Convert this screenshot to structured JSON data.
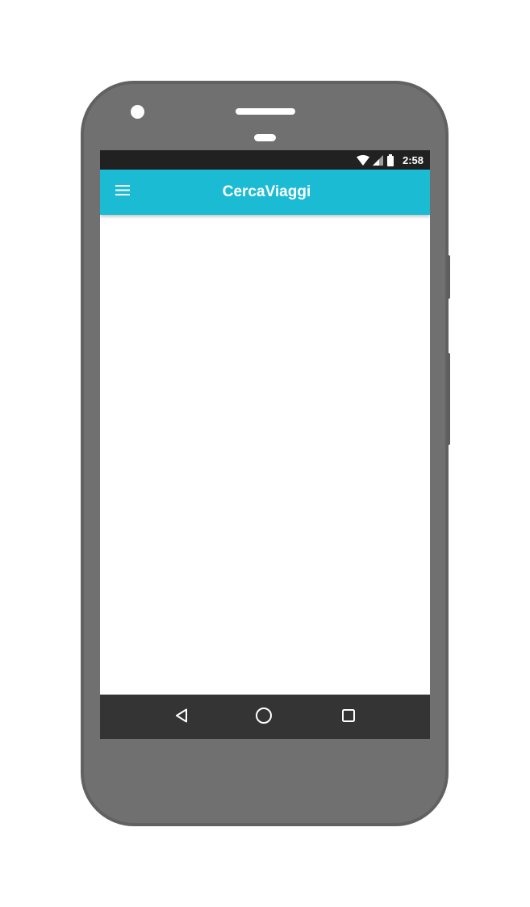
{
  "status_bar": {
    "time": "2:58",
    "icons": [
      "wifi-icon",
      "cellular-signal-icon",
      "battery-icon"
    ]
  },
  "app_bar": {
    "title": "CercaViaggi",
    "menu_icon": "hamburger-menu-icon",
    "background_color": "#1cbbd4"
  },
  "navigation_bar": {
    "buttons": [
      "back-icon",
      "home-icon",
      "recents-icon"
    ]
  }
}
